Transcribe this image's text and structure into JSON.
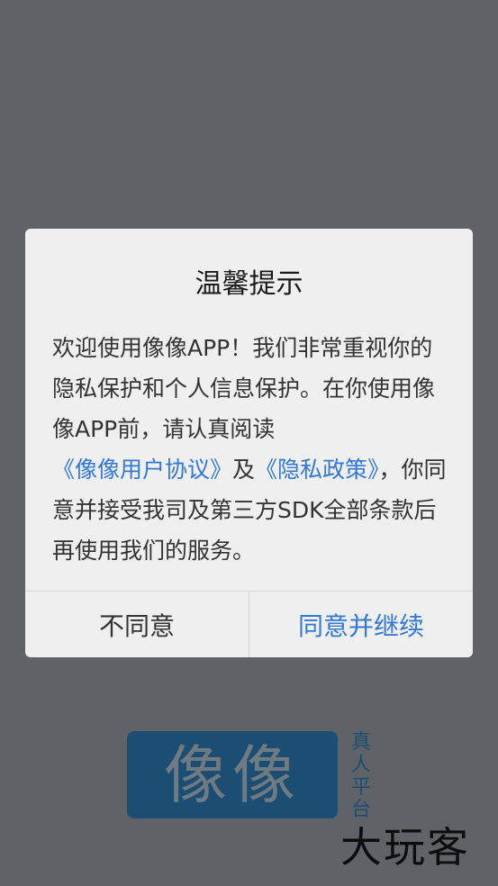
{
  "splash": {
    "logo_text": "像像",
    "logo_subtitle": "真人平台",
    "watermark": "大玩客"
  },
  "dialog": {
    "title": "温馨提示",
    "body_part1": "欢迎使用像像APP！我们非常重视你的隐私保护和个人信息保护。在你使用像像APP前，请认真阅读",
    "user_agreement_link": "《像像用户协议》",
    "and_text": "及",
    "privacy_policy_link": "《隐私政策》",
    "body_part2": "，你同意并接受我司及第三方SDK全部条款后再使用我们的服务。",
    "disagree_label": "不同意",
    "agree_label": "同意并继续"
  },
  "colors": {
    "overlay": "#5f6368",
    "dialog_bg": "#efefef",
    "link": "#3478d6",
    "logo_bg": "#1c4e73"
  }
}
